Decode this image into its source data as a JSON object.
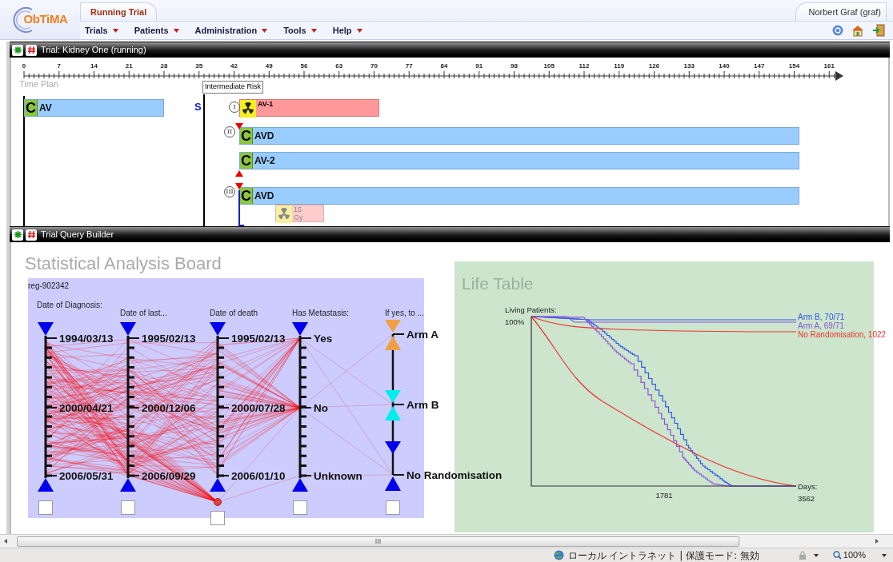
{
  "app": {
    "logo": "ObTiMA",
    "tab": "Running Trial",
    "user": "Norbert Graf (graf)"
  },
  "menu": [
    {
      "label": "Trials"
    },
    {
      "label": "Patients"
    },
    {
      "label": "Administration"
    },
    {
      "label": "Tools"
    },
    {
      "label": "Help"
    }
  ],
  "trial_panel": {
    "title": "Trial: Kidney One (running)",
    "ticks": [
      "0",
      "7",
      "14",
      "21",
      "28",
      "35",
      "42",
      "49",
      "56",
      "63",
      "70",
      "77",
      "84",
      "91",
      "98",
      "105",
      "112",
      "119",
      "126",
      "133",
      "140",
      "147",
      "154",
      "161"
    ],
    "section_label": "Time Plan",
    "tooltip": "Intermediate Risk",
    "stratum_marker": "S",
    "blocks": [
      {
        "kind": "chemo",
        "letter": "C",
        "label": "AV"
      },
      {
        "kind": "radio",
        "label": "AV-1",
        "arm": "I"
      },
      {
        "kind": "chemo",
        "letter": "C",
        "label": "AVD",
        "arm": "II"
      },
      {
        "kind": "chemo",
        "letter": "C",
        "label": "AV-2"
      },
      {
        "kind": "chemo",
        "letter": "C",
        "label": "AVD",
        "arm": "III"
      },
      {
        "kind": "dose",
        "label": "15 Gy"
      }
    ]
  },
  "query_panel": {
    "title": "Trial Query Builder"
  },
  "analysis_board": {
    "title": "Statistical Analysis Board",
    "id": "reg-902342",
    "axes": [
      {
        "label": "Date of Diagnosis:",
        "checked": false,
        "values": [
          {
            "label": "1994/03/13"
          },
          {
            "label": "2000/04/21"
          },
          {
            "label": "2006/05/31"
          }
        ]
      },
      {
        "label": "Date of last...",
        "checked": false,
        "values": [
          {
            "label": "1995/02/13"
          },
          {
            "label": "2000/12/06"
          },
          {
            "label": "2006/09/29"
          }
        ]
      },
      {
        "label": "Date of death",
        "checked": false,
        "values": [
          {
            "label": "1995/02/13"
          },
          {
            "label": "2000/07/28"
          },
          {
            "label": "2006/01/10"
          }
        ]
      },
      {
        "label": "Has Metastasis:",
        "checked": false,
        "values": [
          {
            "label": "Yes"
          },
          {
            "label": "No"
          },
          {
            "label": "Unknown"
          }
        ]
      },
      {
        "label": "If yes, to ...",
        "checked": false,
        "values": [
          {
            "label": "Arm A",
            "color": "#f0a040"
          },
          {
            "label": "Arm B",
            "color": "#00eeee"
          },
          {
            "label": "No Randomisation",
            "color": "#0000ee"
          }
        ]
      }
    ]
  },
  "life_table": {
    "title": "Life Table",
    "ylabel": "Living Patients:",
    "ytick": "100%",
    "xlabel": "Days:",
    "xticks": [
      "1781",
      "3562"
    ],
    "series": [
      {
        "label": "Arm B, 70/71",
        "color": "#3355ee"
      },
      {
        "label": "Arm A, 69/71",
        "color": "#8855dd"
      },
      {
        "label": "No Randomisation, 1022",
        "color": "#ee3333"
      }
    ]
  },
  "status_bar": {
    "zone": "ローカル イントラネット | 保護モード: 無効",
    "zoom": "100%"
  }
}
